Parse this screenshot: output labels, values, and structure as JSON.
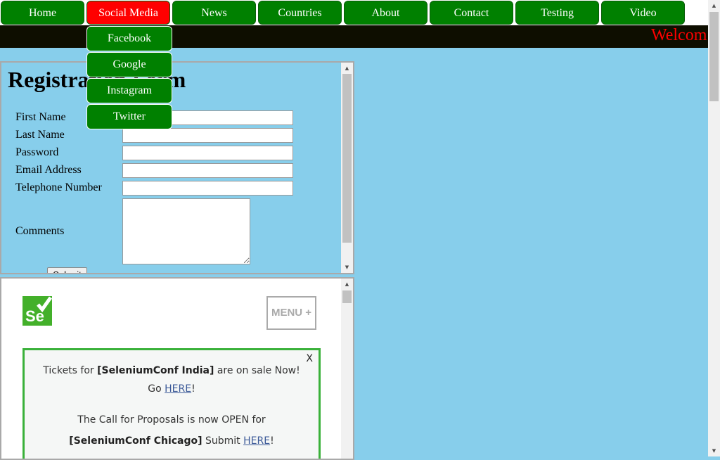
{
  "nav": {
    "items": [
      "Home",
      "Social Media",
      "News",
      "Countries",
      "About",
      "Contact",
      "Testing",
      "Video"
    ],
    "active": "Social Media"
  },
  "banner": {
    "text": "Welcom"
  },
  "dropdown": {
    "items": [
      "Facebook",
      "Google",
      "Instagram",
      "Twitter"
    ]
  },
  "form": {
    "title": "Registration Form",
    "fields": [
      {
        "label": "First Name",
        "value": ""
      },
      {
        "label": "Last Name",
        "value": ""
      },
      {
        "label": "Password",
        "value": ""
      },
      {
        "label": "Email Address",
        "value": ""
      },
      {
        "label": "Telephone Number",
        "value": ""
      }
    ],
    "comments_label": "Comments",
    "comments_value": "",
    "submit_label": "Submit"
  },
  "selenium": {
    "logo_text": "Se",
    "menu_label": "MENU +",
    "close_label": "X",
    "notice1": {
      "pre": "Tickets for ",
      "bold": "[SeleniumConf India]",
      "mid": " are on sale Now! Go ",
      "link": "HERE",
      "post": "!"
    },
    "notice2": {
      "pre": "The Call for Proposals is now OPEN for ",
      "bold": "[SeleniumConf Chicago]",
      "mid": " Submit ",
      "link": "HERE",
      "post": "!"
    }
  },
  "colors": {
    "nav_bg": "#008000",
    "nav_active": "#ff0000",
    "page_bg": "#87ceeb",
    "banner_bg": "#0e0e00",
    "banner_text": "#ff0000",
    "selenium_green": "#43b02a"
  }
}
